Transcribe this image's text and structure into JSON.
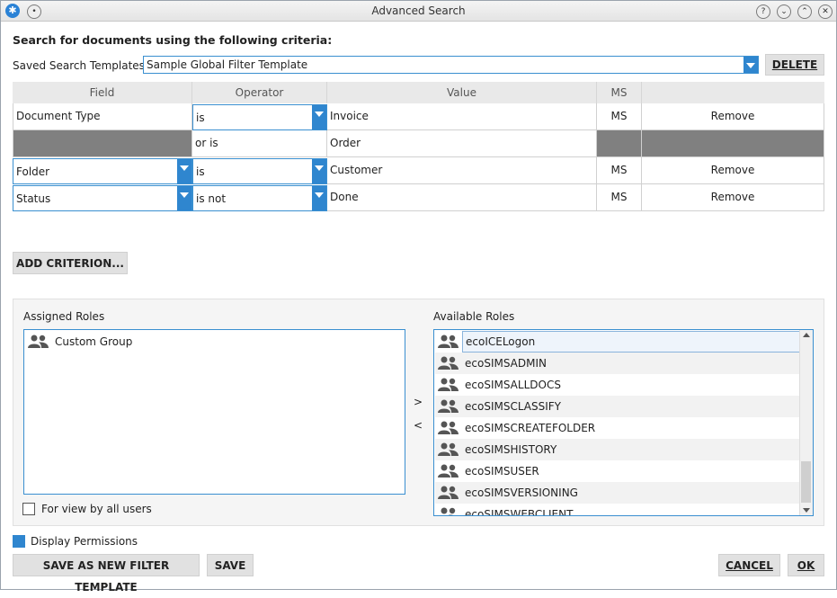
{
  "window": {
    "title": "Advanced Search"
  },
  "criteria_heading": "Search for documents using the following criteria:",
  "templates": {
    "label": "Saved Search Templates:",
    "selected": "Sample Global Filter Template",
    "delete_label": "DELETE"
  },
  "table": {
    "headers": [
      "Field",
      "Operator",
      "Value",
      "MS",
      ""
    ],
    "rows": [
      {
        "field": "Document Type",
        "operator": "is",
        "value": "Invoice",
        "ms": "MS",
        "action": "Remove"
      },
      {
        "field": "",
        "operator": "or is",
        "value": "Order",
        "ms": "",
        "action": ""
      },
      {
        "field": "Folder",
        "operator": "is",
        "value": "Customer",
        "ms": "MS",
        "action": "Remove"
      },
      {
        "field": "Status",
        "operator": "is not",
        "value": "Done",
        "ms": "MS",
        "action": "Remove"
      }
    ]
  },
  "add_criterion_label": "ADD CRITERION...",
  "assigned_roles": {
    "label": "Assigned Roles",
    "items": [
      "Custom Group"
    ]
  },
  "available_roles": {
    "label": "Available Roles",
    "items": [
      "ecoICELogon",
      "ecoSIMSADMIN",
      "ecoSIMSALLDOCS",
      "ecoSIMSCLASSIFY",
      "ecoSIMSCREATEFOLDER",
      "ecoSIMSHISTORY",
      "ecoSIMSUSER",
      "ecoSIMSVERSIONING",
      "ecoSIMSWEBCLIENT"
    ]
  },
  "move_right": ">",
  "move_left": "<",
  "for_view_all": "For view by all users",
  "display_permissions": "Display Permissions",
  "buttons": {
    "save_new": "SAVE AS NEW FILTER TEMPLATE",
    "save": "SAVE",
    "cancel": "CANCEL",
    "ok": "OK"
  },
  "colors": {
    "accent": "#2f86cf",
    "disabled_cell": "#808080"
  }
}
